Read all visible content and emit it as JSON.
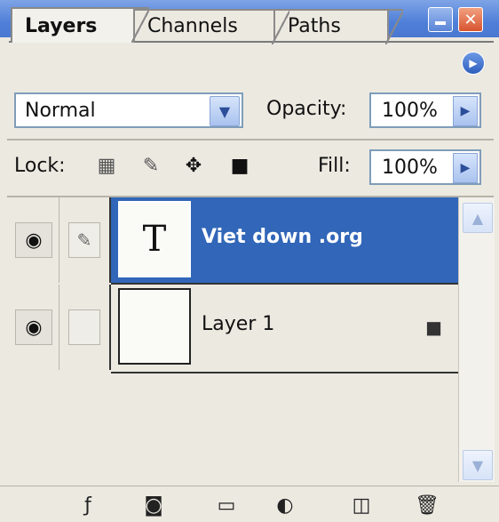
{
  "tabs": [
    {
      "label": "Layers",
      "active": true
    },
    {
      "label": "Channels",
      "active": false
    },
    {
      "label": "Paths",
      "active": false
    }
  ],
  "blend_mode": "Normal",
  "opacity": {
    "label": "Opacity:",
    "value": "100%"
  },
  "fill": {
    "label": "Fill:",
    "value": "100%"
  },
  "lock": {
    "label": "Lock:"
  },
  "layers": [
    {
      "name": "Viet down .org",
      "thumbnail_text": "T",
      "selected": true,
      "visible": true,
      "locked": false
    },
    {
      "name": "Layer 1",
      "thumbnail_text": "",
      "selected": false,
      "visible": true,
      "locked": true
    }
  ],
  "colors": {
    "title_bar": "#4f7fd8",
    "selection": "#3166b8",
    "panel": "#ece9e1"
  }
}
